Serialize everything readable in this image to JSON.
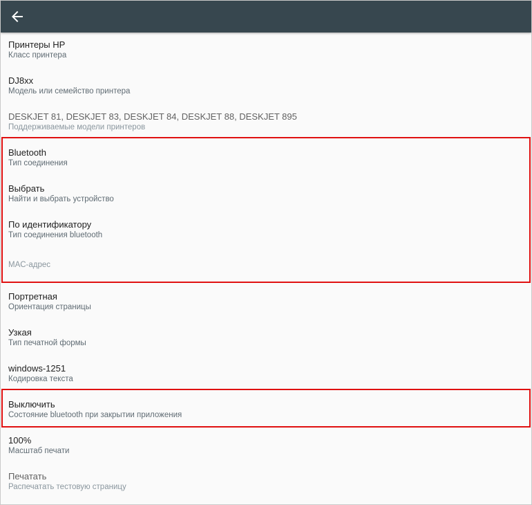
{
  "header": {
    "back_icon": "arrow-left-icon",
    "background": "#37474f"
  },
  "settings": {
    "printer_class": {
      "value": "Принтеры HP",
      "label": "Класс принтера"
    },
    "printer_model": {
      "value": "DJ8xx",
      "label": "Модель или семейство принтера"
    },
    "supported_models": {
      "value": "DESKJET 81, DESKJET 83, DESKJET 84, DESKJET 88, DESKJET 895",
      "label": "Поддерживаемые модели принтеров"
    },
    "connection_type": {
      "value": "Bluetooth",
      "label": "Тип соединения"
    },
    "select_device": {
      "value": "Выбрать",
      "label": "Найти и выбрать устройство"
    },
    "bluetooth_connection": {
      "value": "По идентификатору",
      "label": "Тип соединения bluetooth"
    },
    "mac_address": {
      "placeholder": "MAC-адрес"
    },
    "orientation": {
      "value": "Портретная",
      "label": "Ориентация страницы"
    },
    "print_form": {
      "value": "Узкая",
      "label": "Тип печатной формы"
    },
    "encoding": {
      "value": "windows-1251",
      "label": "Кодировка текста"
    },
    "bluetooth_on_close": {
      "value": "Выключить",
      "label": "Состояние bluetooth при закрытии приложения"
    },
    "print_scale": {
      "value": "100%",
      "label": "Масштаб печати"
    },
    "test_print": {
      "value": "Печатать",
      "label": "Распечатать тестовую страницу"
    }
  },
  "highlight_color": "#e01010"
}
